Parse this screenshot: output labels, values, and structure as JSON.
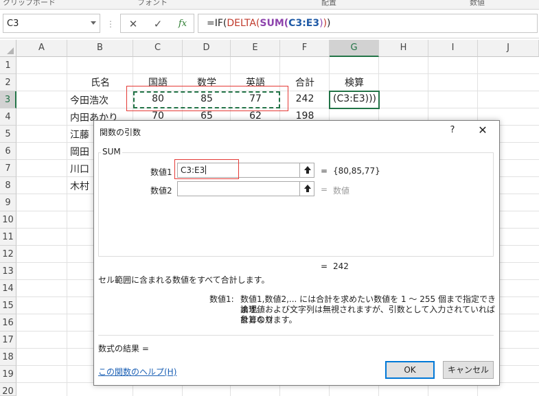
{
  "ribbon": {
    "groups": [
      "クリップボード",
      "フォント",
      "配置",
      "数値"
    ]
  },
  "formula_bar": {
    "name_box": "C3",
    "formula_parts": [
      "=IF(",
      "DELTA(",
      "SUM(",
      "C3:E3",
      ")",
      ")",
      ")"
    ]
  },
  "columns": [
    "A",
    "B",
    "C",
    "D",
    "E",
    "F",
    "G",
    "H",
    "I",
    "J"
  ],
  "rows": [
    "1",
    "2",
    "3",
    "4",
    "5",
    "6",
    "7",
    "8",
    "9",
    "10",
    "11",
    "12",
    "13",
    "14",
    "15",
    "16",
    "17",
    "18",
    "19",
    "20"
  ],
  "sheet": {
    "headers": [
      "氏名",
      "国語",
      "数学",
      "英語",
      "合計",
      "検算"
    ],
    "row3": {
      "name": "今田浩次",
      "c": "80",
      "d": "85",
      "e": "77",
      "f": "242",
      "g": "(C3:E3)))"
    },
    "row4": {
      "name": "内田あかり",
      "c": "70",
      "d": "65",
      "e": "62",
      "f": "198"
    },
    "visible_names": [
      "江藤",
      "岡田",
      "川口",
      "木村"
    ]
  },
  "dialog": {
    "title": "関数の引数",
    "help": "?",
    "close": "✕",
    "function_name": "SUM",
    "arg1_label": "数値1",
    "arg1_value": "C3:E3",
    "arg1_result": "{80,85,77}",
    "arg2_label": "数値2",
    "arg2_value": "",
    "arg2_result": "数値",
    "equals": "=",
    "result": "242",
    "description": "セル範囲に含まれる数値をすべて合計します。",
    "arg_desc_label": "数値1:",
    "arg_desc_line1": "数値1,数値2,... には合計を求めたい数値を 1 ～ 255 個まで指定できます。",
    "arg_desc_line2": "論理値および文字列は無視されますが、引数として入力されていれば計算の対",
    "arg_desc_line3": "象となります。",
    "formula_result_label": "数式の結果 =",
    "help_link": "この関数のヘルプ(H)",
    "ok": "OK",
    "cancel": "キャンセル"
  }
}
